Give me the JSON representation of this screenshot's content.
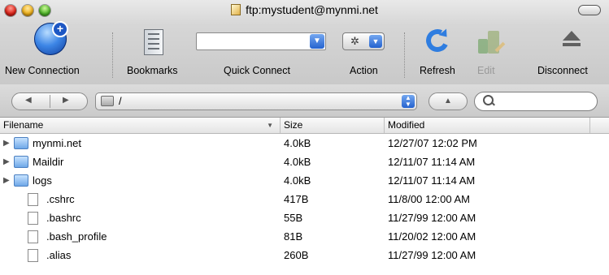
{
  "window": {
    "title": "ftp:mystudent@mynmi.net"
  },
  "toolbar": {
    "new_connection": "New Connection",
    "bookmarks": "Bookmarks",
    "quick_connect": "Quick Connect",
    "quick_connect_value": "",
    "action": "Action",
    "refresh": "Refresh",
    "edit": "Edit",
    "disconnect": "Disconnect"
  },
  "pathbar": {
    "path": "/",
    "search_value": ""
  },
  "table": {
    "columns": {
      "filename": "Filename",
      "size": "Size",
      "modified": "Modified"
    },
    "rows": [
      {
        "type": "folder",
        "name": "mynmi.net",
        "size": "4.0kB",
        "modified": "12/27/07 12:02 PM"
      },
      {
        "type": "folder",
        "name": "Maildir",
        "size": "4.0kB",
        "modified": "12/11/07 11:14 AM"
      },
      {
        "type": "folder",
        "name": "logs",
        "size": "4.0kB",
        "modified": "12/11/07 11:14 AM"
      },
      {
        "type": "file",
        "name": ".cshrc",
        "size": "417B",
        "modified": "11/8/00 12:00 AM"
      },
      {
        "type": "file",
        "name": ".bashrc",
        "size": "55B",
        "modified": "11/27/99 12:00 AM"
      },
      {
        "type": "file",
        "name": ".bash_profile",
        "size": "81B",
        "modified": "11/20/02 12:00 AM"
      },
      {
        "type": "file",
        "name": ".alias",
        "size": "260B",
        "modified": "11/27/99 12:00 AM"
      }
    ]
  }
}
